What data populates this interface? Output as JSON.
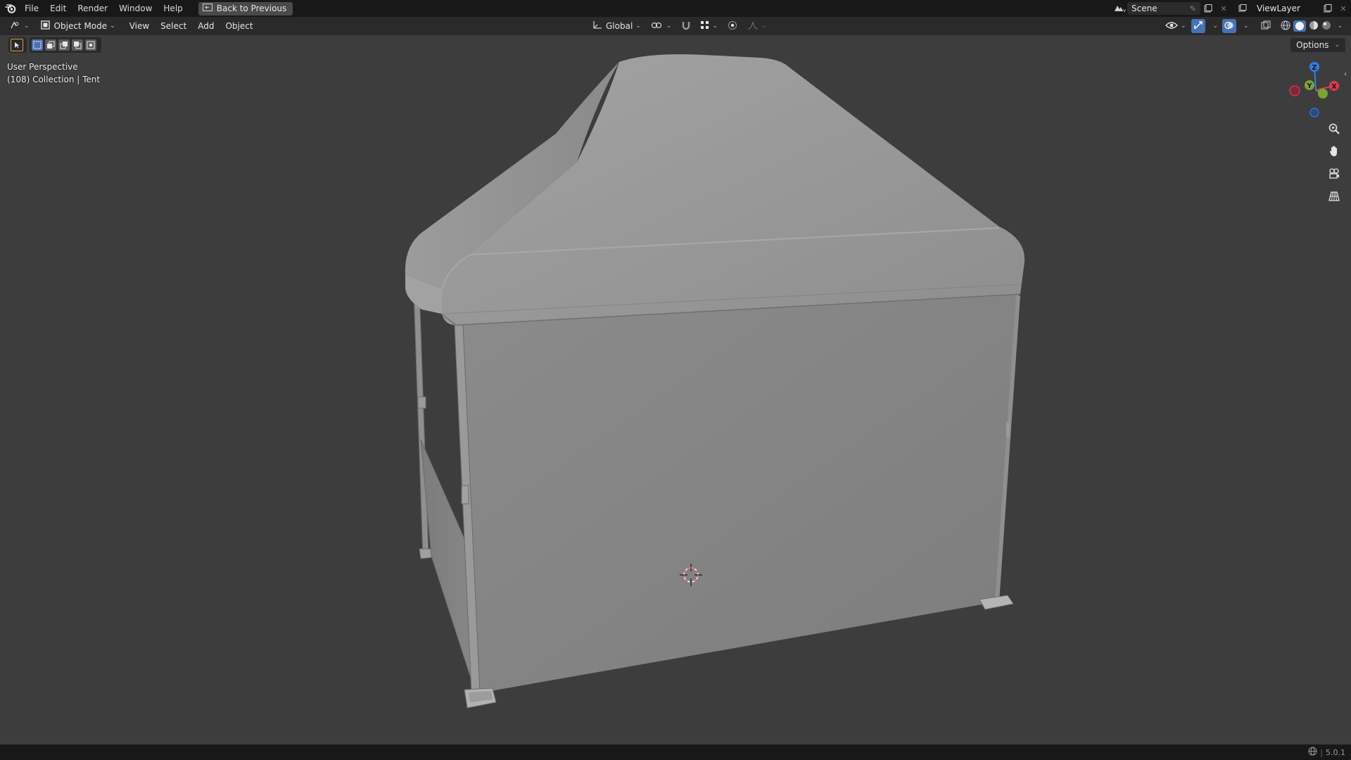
{
  "topbar": {
    "menus": [
      "File",
      "Edit",
      "Render",
      "Window",
      "Help"
    ],
    "back_button": "Back to Previous",
    "scene_name": "Scene",
    "view_layer": "ViewLayer"
  },
  "header": {
    "mode": "Object Mode",
    "menus": [
      "View",
      "Select",
      "Add",
      "Object"
    ],
    "transform_orientation": "Global",
    "options_label": "Options"
  },
  "viewport": {
    "perspective_label": "User Perspective",
    "collection_label": "(108) Collection | Tent"
  },
  "gizmo": {
    "z_label": "Z",
    "y_label": "Y",
    "x_label": "X",
    "colors": {
      "x": "#e0394e",
      "y": "#7aa531",
      "z": "#2e7ff0"
    }
  },
  "status": {
    "version": "5.0.1"
  },
  "colors": {
    "accent": "#4772b3",
    "topbar_bg": "#181818",
    "header_bg": "#2a2a2a",
    "viewport_bg": "#3d3d3d"
  }
}
